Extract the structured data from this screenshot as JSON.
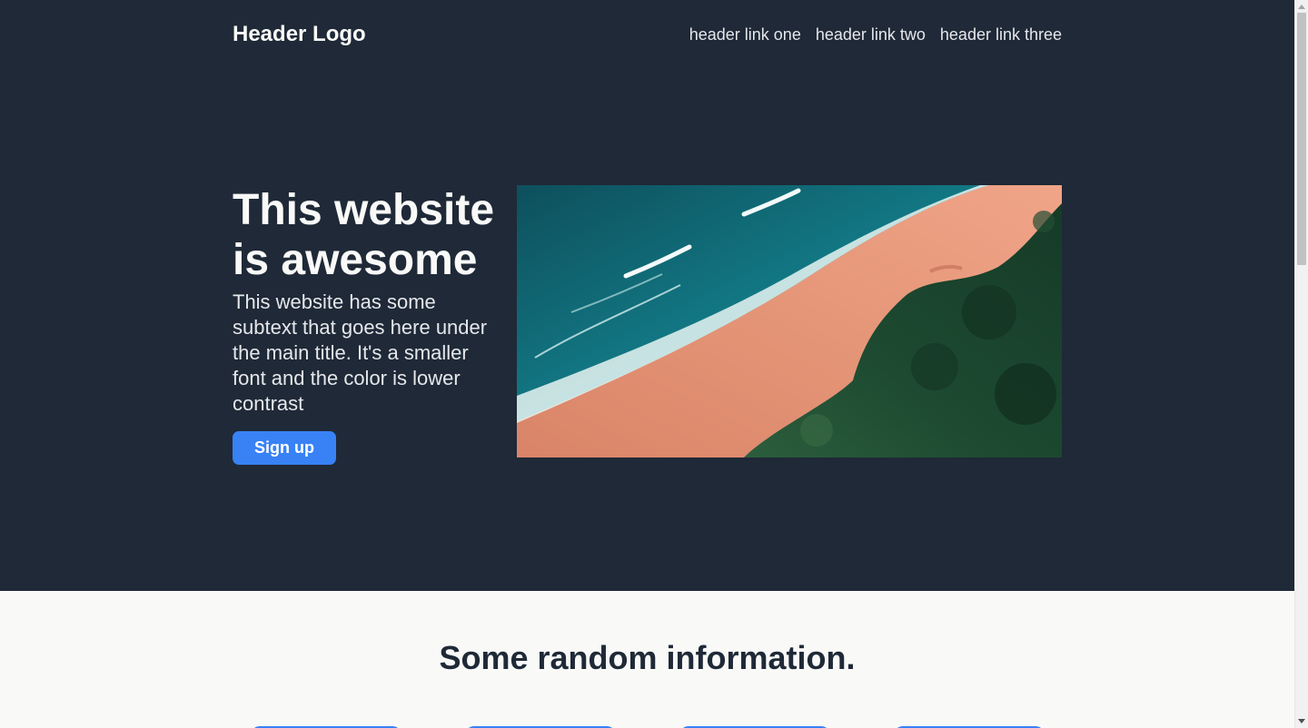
{
  "header": {
    "logo": "Header Logo",
    "links": [
      "header link one",
      "header link two",
      "header link three"
    ]
  },
  "hero": {
    "title": "This website is awesome",
    "subtext": "This website has some subtext that goes here under the main title. It's a smaller font and the color is lower contrast",
    "signup_label": "Sign up",
    "image": "aerial-beach-photo"
  },
  "info": {
    "title": "Some random information."
  },
  "colors": {
    "hero_bg": "#1f2937",
    "accent": "#3882f6",
    "page_bg": "#f9faf8",
    "text_light": "#f9faf8",
    "text_muted": "#e5e7eb",
    "text_dark": "#1f2937"
  }
}
